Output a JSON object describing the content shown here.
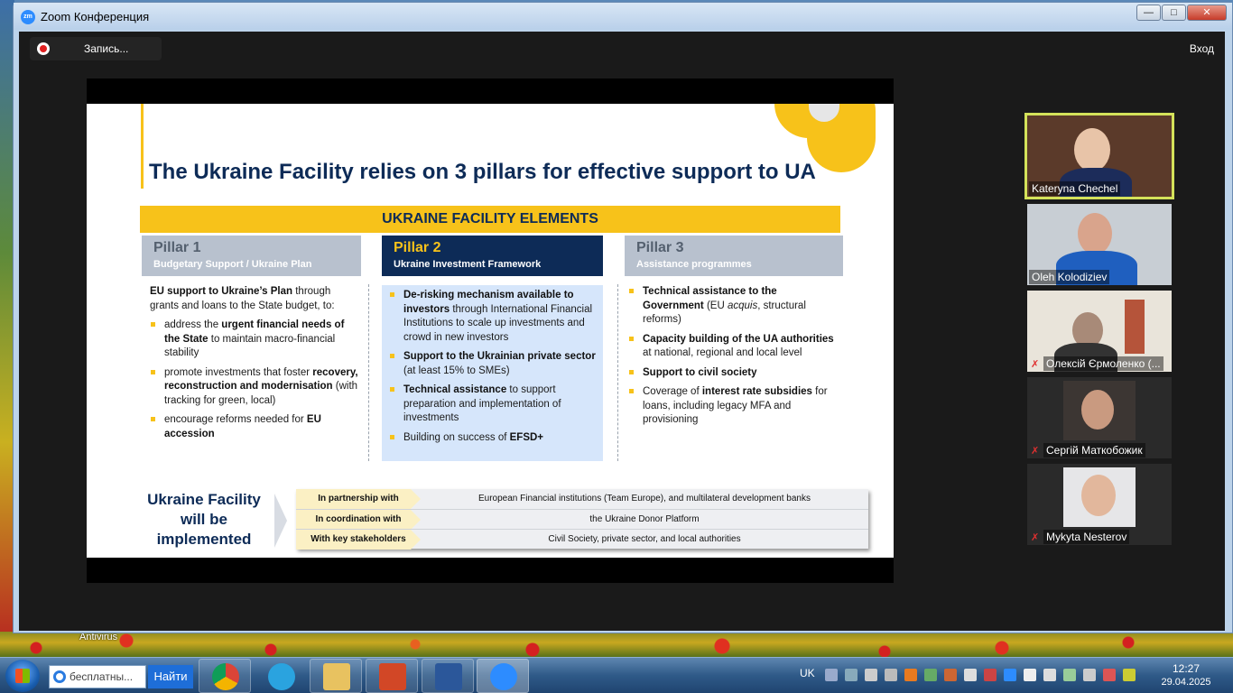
{
  "window": {
    "title": "Zoom Конференция",
    "app_icon": "zm"
  },
  "toolbar": {
    "record_label": "Запись...",
    "login_label": "Вход"
  },
  "slide": {
    "title": "The Ukraine Facility relies on 3 pillars for effective support to UA",
    "banner": "UKRAINE FACILITY ELEMENTS",
    "pillars": [
      {
        "title": "Pillar 1",
        "subtitle": "Budgetary Support / Ukraine Plan"
      },
      {
        "title": "Pillar 2",
        "subtitle": "Ukraine Investment Framework"
      },
      {
        "title": "Pillar 3",
        "subtitle": "Assistance programmes"
      }
    ],
    "pillar1": {
      "intro_bold": "EU support to Ukraine’s Plan",
      "intro_rest": " through grants and loans to the State budget, to:",
      "b1_pre": "address the ",
      "b1_bold": "urgent financial needs of the State",
      "b1_post": " to maintain macro-financial stability",
      "b2_pre": "promote investments that foster ",
      "b2_bold": "recovery, reconstruction and modernisation",
      "b2_post": " (with tracking for green, local)",
      "b3_pre": "encourage reforms needed for ",
      "b3_bold": "EU accession"
    },
    "pillar2": {
      "b1_bold": "De-risking mechanism available to investors",
      "b1_post": " through International Financial Institutions to scale up investments and crowd in new investors",
      "b2_bold": "Support to the Ukrainian private sector",
      "b2_post": " (at least 15% to SMEs)",
      "b3_bold": "Technical assistance",
      "b3_post": " to support preparation and implementation of investments",
      "b4_pre": "Building on success of ",
      "b4_bold": "EFSD+"
    },
    "pillar3": {
      "b1_bold": "Technical assistance to the Government",
      "b1_mid": " (EU ",
      "b1_ital": "acquis",
      "b1_post": ", structural reforms)",
      "b2_bold": "Capacity building of the UA authorities",
      "b2_post": " at national, regional and local level",
      "b3_bold": "Support to civil society",
      "b4_pre": "Coverage of ",
      "b4_bold": "interest rate subsidies",
      "b4_post": " for loans, including legacy MFA and provisioning"
    },
    "implemented_title": "Ukraine Facility will be implemented",
    "implementation": [
      {
        "label": "In partnership with",
        "value": "European Financial institutions (Team Europe), and multilateral development banks"
      },
      {
        "label": "In coordination with",
        "value": "the Ukraine Donor Platform"
      },
      {
        "label": "With key stakeholders",
        "value": "Civil Society, private sector, and local authorities"
      }
    ]
  },
  "participants": [
    {
      "name": "Kateryna Chechel",
      "muted": false,
      "active": true
    },
    {
      "name": "Oleh Kolodiziev",
      "muted": false,
      "active": false
    },
    {
      "name": "Олексій Єрмоленко (...",
      "muted": true,
      "active": false
    },
    {
      "name": "Сергій Маткобожик",
      "muted": true,
      "active": false
    },
    {
      "name": "Mykyta Nesterov",
      "muted": true,
      "active": false
    }
  ],
  "taskbar": {
    "search_text": "бесплатны...",
    "search_button": "Найти",
    "language": "UK",
    "time": "12:27",
    "date": "29.04.2025",
    "apps": [
      "chrome-icon",
      "telegram-icon",
      "file-explorer-icon",
      "powerpoint-icon",
      "word-icon",
      "zoom-icon"
    ]
  },
  "desktop": {
    "antivirus_label": "Antivirus"
  },
  "colors": {
    "brand_navy": "#0d2b57",
    "brand_yellow": "#f7c21a",
    "pillar2_bg": "#d6e6fb",
    "zoom_blue": "#2d8cff"
  }
}
